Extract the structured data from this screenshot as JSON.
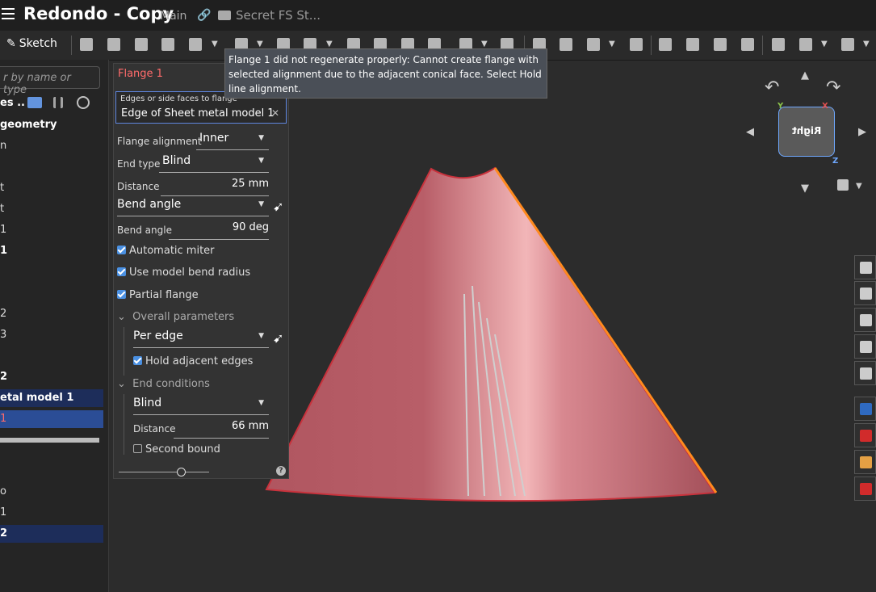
{
  "header": {
    "title": "Redondo - Copy",
    "branch": "Main",
    "folder": "Secret FS St..."
  },
  "toolbar": {
    "sketch_label": "Sketch"
  },
  "left_panel": {
    "filter_placeholder": "r by name or type",
    "features_header": "es",
    "rows": [
      {
        "text": "geometry",
        "bold": true
      },
      {
        "text": "n"
      },
      {
        "text": ""
      },
      {
        "text": "t"
      },
      {
        "text": "t"
      },
      {
        "text": "1"
      },
      {
        "text": " 1",
        "bold": true
      },
      {
        "text": ""
      },
      {
        "text": ""
      },
      {
        "text": "2"
      },
      {
        "text": "3"
      },
      {
        "text": ""
      },
      {
        "text": " 2",
        "bold": true
      },
      {
        "text": "etal model 1",
        "bold": true,
        "sel": true
      },
      {
        "text": "1",
        "red": true,
        "sel2": true
      }
    ],
    "lower_rows": [
      {
        "text": "o"
      },
      {
        "text": "1"
      },
      {
        "text": "2",
        "bold": true,
        "sel": true
      }
    ]
  },
  "dialog": {
    "title": "Flange 1",
    "query_label": "Edges or side faces to flange",
    "query_value": "Edge of Sheet metal model 1",
    "flange_alignment_label": "Flange alignment",
    "flange_alignment_value": "Inner",
    "end_type_label": "End type",
    "end_type_value": "Blind",
    "distance_label": "Distance",
    "distance_value": "25 mm",
    "bend_mode_value": "Bend angle",
    "bend_angle_label": "Bend angle",
    "bend_angle_value": "90 deg",
    "automatic_miter": "Automatic miter",
    "use_model_bend_radius": "Use model bend radius",
    "partial_flange": "Partial flange",
    "overall_parameters": "Overall parameters",
    "per_edge_value": "Per edge",
    "hold_adjacent_edges": "Hold adjacent edges",
    "end_conditions": "End conditions",
    "end_blind_value": "Blind",
    "end_distance_label": "Distance",
    "end_distance_value": "66 mm",
    "second_bound": "Second bound"
  },
  "tooltip": {
    "text": "Flange 1 did not regenerate properly: Cannot create flange with selected alignment due to the adjacent conical face. Select Hold line alignment."
  },
  "view_cube": {
    "face": "Right",
    "axis_y": "Y",
    "axis_x": "X",
    "axis_z": "Z"
  },
  "colors": {
    "cone_fill": "#b8606a",
    "cone_edge": "#c8323c",
    "accent": "#4a90e2",
    "error": "#ff6b6b"
  }
}
